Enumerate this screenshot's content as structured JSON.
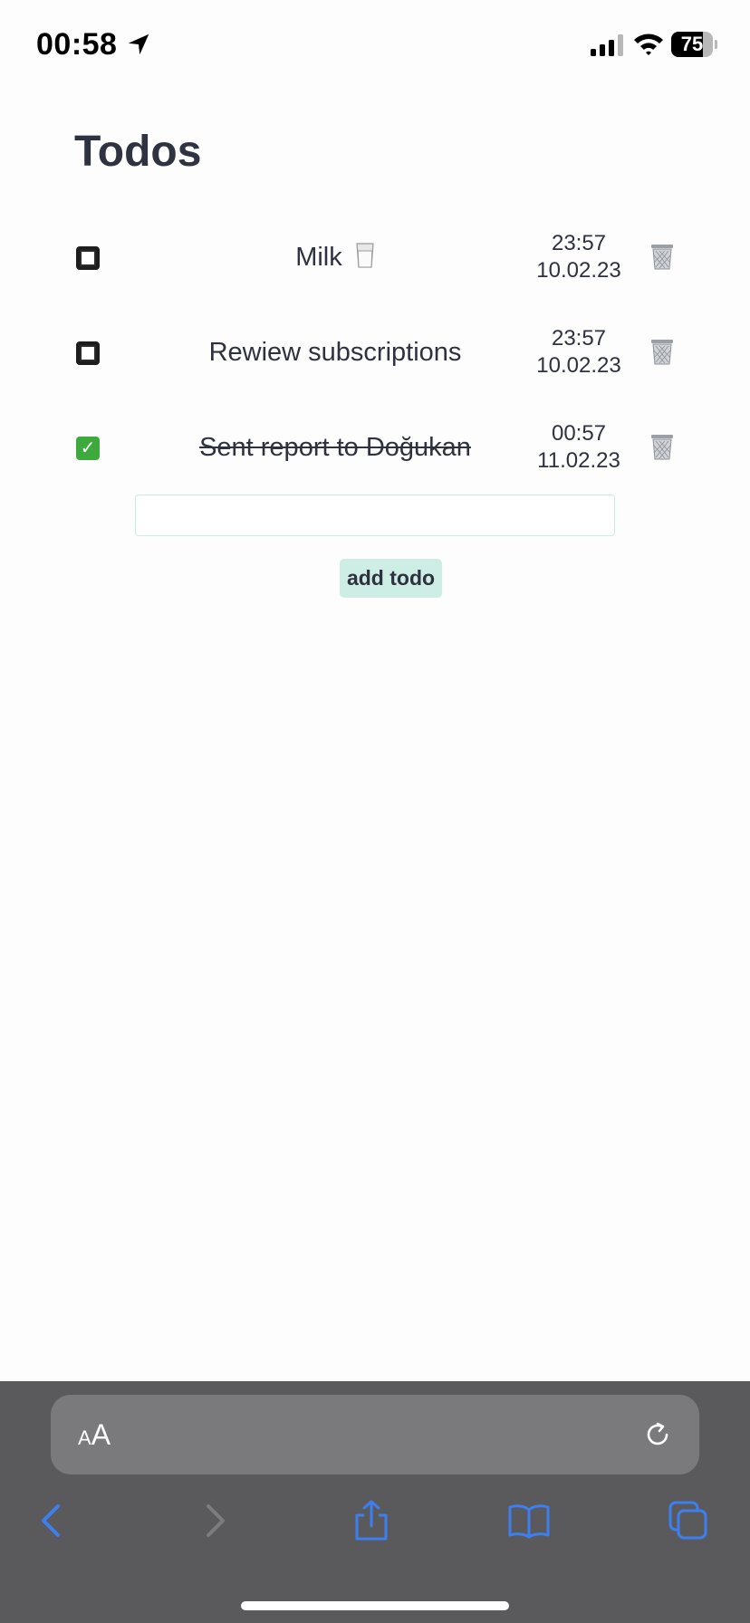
{
  "status_bar": {
    "time": "00:58",
    "battery": "75",
    "battery_level": 0.75
  },
  "page": {
    "title": "Todos"
  },
  "todos": [
    {
      "text": "Milk",
      "emoji": "milk-glass-icon",
      "completed": false,
      "time": "23:57",
      "date": "10.02.23"
    },
    {
      "text": "Rewiew subscriptions",
      "completed": false,
      "time": "23:57",
      "date": "10.02.23"
    },
    {
      "text": "Sent report to Doğukan",
      "completed": true,
      "time": "00:57",
      "date": "11.02.23"
    }
  ],
  "new_todo": {
    "value": "",
    "placeholder": ""
  },
  "actions": {
    "add_label": "add todo"
  },
  "browser": {
    "aa_small": "A",
    "aa_large": "A"
  },
  "colors": {
    "text": "#2e3140",
    "button_bg": "#cdeee4",
    "input_border": "#c9ece3",
    "checked_green": "#3eaa3e",
    "toolbar_bg": "#5a5a5c",
    "toolbar_icon": "#3d7ff0"
  }
}
